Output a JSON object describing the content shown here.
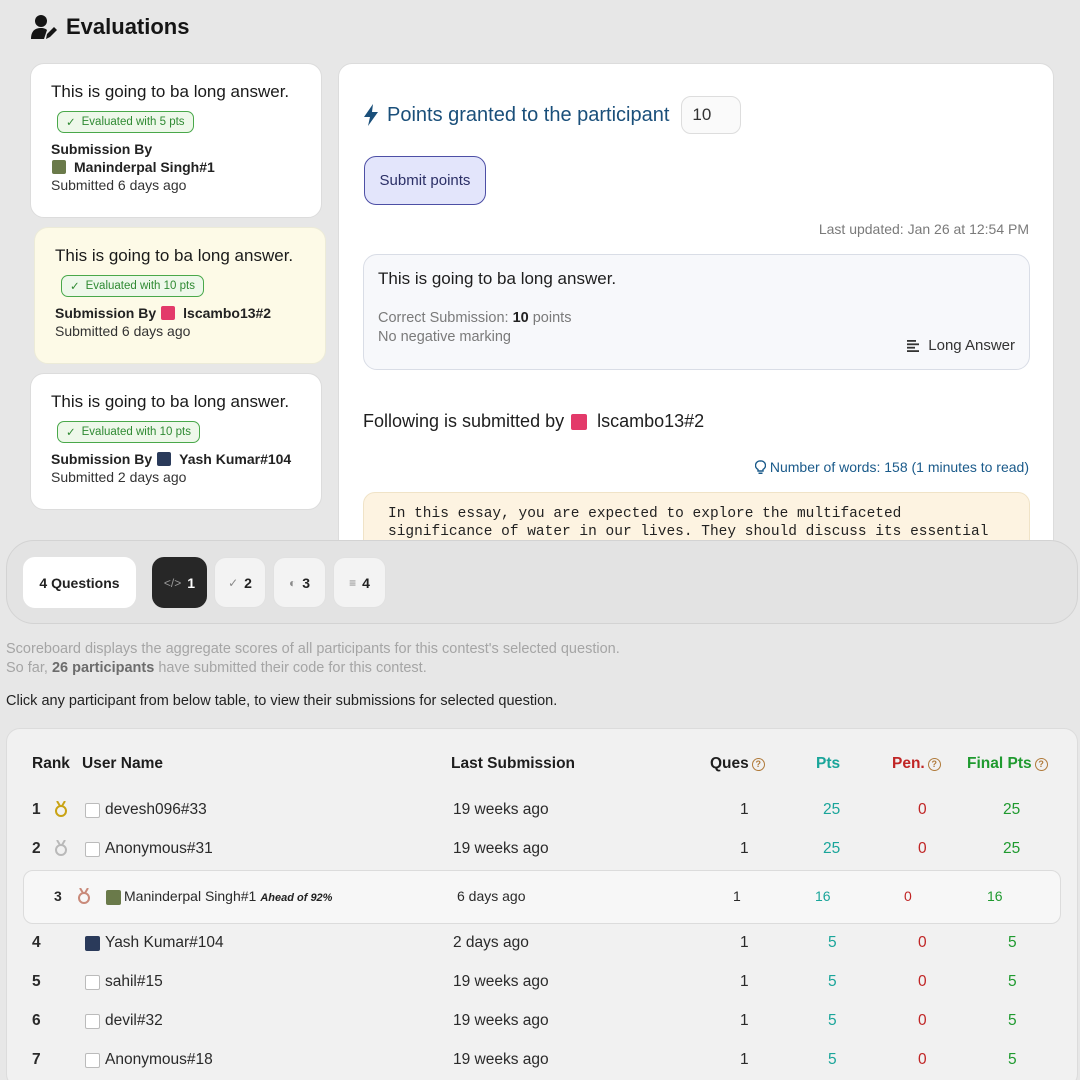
{
  "header": {
    "title": "Evaluations",
    "icon": "user-edit-icon"
  },
  "evaluations": [
    {
      "question": "This is going to ba long answer.",
      "badge": "Evaluated with 5 pts",
      "submission_by_label": "Submission By",
      "user": "Maninderpal Singh#1",
      "submitted": "Submitted 6 days ago"
    },
    {
      "question": "This is going to ba long answer.",
      "badge": "Evaluated with 10 pts",
      "submission_by_label": "Submission By",
      "user": "lscambo13#2",
      "submitted": "Submitted 6 days ago"
    },
    {
      "question": "This is going to ba long answer.",
      "badge": "Evaluated with 10 pts",
      "submission_by_label": "Submission By",
      "user": "Yash Kumar#104",
      "submitted": "Submitted 2 days ago"
    }
  ],
  "detail": {
    "points_label": "Points granted to the participant",
    "points_value": "10",
    "submit_label": "Submit points",
    "last_updated": "Last updated: Jan 26 at 12:54 PM",
    "question": "This is going to ba long answer.",
    "correct_prefix": "Correct Submission: ",
    "correct_points": "10",
    "correct_suffix": " points",
    "negative": "No negative marking",
    "type": "Long Answer",
    "following_prefix": "Following is submitted by",
    "following_user": "lscambo13#2",
    "words": "Number of words: 158 (1 minutes to read)",
    "essay": "In this essay, you are expected to explore the multifaceted significance of water in our lives. They should discuss its essential role in sustaining"
  },
  "tabs": {
    "count_label": "4 Questions",
    "items": [
      {
        "num": "1",
        "icon": "code-icon",
        "glyph": "</>"
      },
      {
        "num": "2",
        "icon": "double-check-icon",
        "glyph": "✓"
      },
      {
        "num": "3",
        "icon": "half-circle-icon",
        "glyph": "◐"
      },
      {
        "num": "4",
        "icon": "text-lines-icon",
        "glyph": "≡"
      }
    ]
  },
  "info": {
    "line1": "Scoreboard displays the aggregate scores of all participants for this contest's selected question.",
    "line2_prefix": "So far, ",
    "line2_bold": "26 participants",
    "line2_suffix": " have submitted their code for this contest.",
    "click": "Click any participant from below table, to view their submissions for selected question."
  },
  "scoreboard": {
    "headers": {
      "rank": "Rank",
      "user": "User Name",
      "last": "Last Submission",
      "ques": "Ques",
      "pts": "Pts",
      "pen": "Pen.",
      "final": "Final Pts"
    },
    "rows": [
      {
        "rank": "1",
        "medal": "gold",
        "user": "devesh096#33",
        "last": "19 weeks ago",
        "ques": "1",
        "pts": "25",
        "pen": "0",
        "final": "25",
        "avatar": "grey"
      },
      {
        "rank": "2",
        "medal": "silver",
        "user": "Anonymous#31",
        "last": "19 weeks ago",
        "ques": "1",
        "pts": "25",
        "pen": "0",
        "final": "25",
        "avatar": "grey"
      },
      {
        "rank": "3",
        "medal": "bronze",
        "user": "Maninderpal Singh#1",
        "ahead": "Ahead of 92%",
        "last": "6 days ago",
        "ques": "1",
        "pts": "16",
        "pen": "0",
        "final": "16",
        "avatar": "green"
      },
      {
        "rank": "4",
        "user": "Yash Kumar#104",
        "last": "2 days ago",
        "ques": "1",
        "pts": "5",
        "pen": "0",
        "final": "5",
        "avatar": "dark"
      },
      {
        "rank": "5",
        "user": "sahil#15",
        "last": "19 weeks ago",
        "ques": "1",
        "pts": "5",
        "pen": "0",
        "final": "5",
        "avatar": "grey"
      },
      {
        "rank": "6",
        "user": "devil#32",
        "last": "19 weeks ago",
        "ques": "1",
        "pts": "5",
        "pen": "0",
        "final": "5",
        "avatar": "grey"
      },
      {
        "rank": "7",
        "user": "Anonymous#18",
        "last": "19 weeks ago",
        "ques": "1",
        "pts": "5",
        "pen": "0",
        "final": "5",
        "avatar": "grey"
      }
    ]
  },
  "colors": {
    "accent_blue": "#1a4f7a",
    "pts": "#1aa59a",
    "pen": "#c02525",
    "final": "#1f9a2f",
    "selected_card": "#fdfae7"
  }
}
